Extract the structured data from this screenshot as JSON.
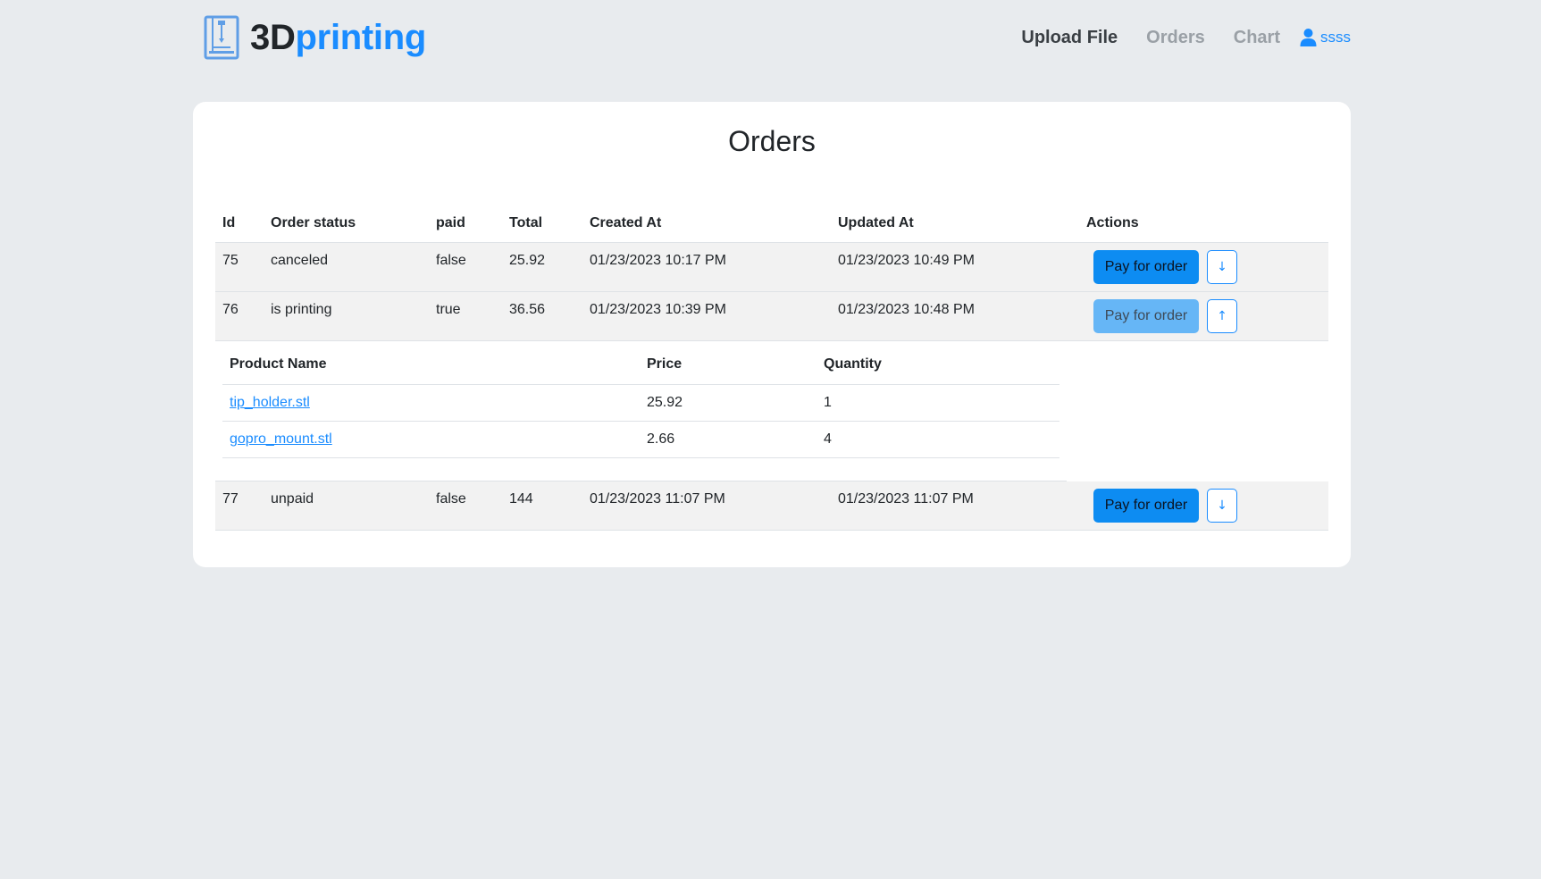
{
  "brand": {
    "prefix": "3D",
    "suffix": "printing"
  },
  "nav": {
    "upload_label": "Upload File",
    "orders_label": "Orders",
    "chart_label": "Chart",
    "username": "ssss"
  },
  "page": {
    "title": "Orders"
  },
  "orders_table": {
    "headers": [
      "Id",
      "Order status",
      "paid",
      "Total",
      "Created At",
      "Updated At",
      "Actions"
    ],
    "rows": [
      {
        "id": "75",
        "status": "canceled",
        "paid": "false",
        "total": "25.92",
        "created": "01/23/2023 10:17 PM",
        "updated": "01/23/2023 10:49 PM",
        "pay_label": "Pay for order",
        "toggle": "↓"
      },
      {
        "id": "76",
        "status": "is printing",
        "paid": "true",
        "total": "36.56",
        "created": "01/23/2023 10:39 PM",
        "updated": "01/23/2023 10:48 PM",
        "pay_label": "Pay for order",
        "toggle": "↑"
      },
      {
        "id": "77",
        "status": "unpaid",
        "paid": "false",
        "total": "144",
        "created": "01/23/2023 11:07 PM",
        "updated": "01/23/2023 11:07 PM",
        "pay_label": "Pay for order",
        "toggle": "↓"
      }
    ]
  },
  "order_items": {
    "headers": [
      "Product Name",
      "Price",
      "Quantity"
    ],
    "rows": [
      {
        "name": "tip_holder.stl",
        "price": "25.92",
        "quantity": "1"
      },
      {
        "name": "gopro_mount.stl",
        "price": "2.66",
        "quantity": "4"
      }
    ]
  },
  "colors": {
    "accent": "#1a8cff",
    "pay_button": "#0d8cf2",
    "pay_button_disabled": "#66b6f6",
    "background": "#e8ebee",
    "row_background": "#f2f2f2"
  },
  "icons": {
    "logo": "printer-icon",
    "user": "user-icon"
  }
}
